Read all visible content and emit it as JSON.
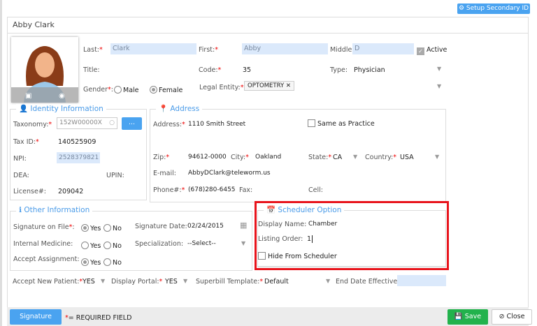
{
  "header": {
    "setup_secondary_id": "Setup Secondary ID",
    "title": "Abby Clark"
  },
  "name": {
    "last_label": "Last:",
    "last": "Clark",
    "first_label": "First:",
    "first": "Abby",
    "middle_label": "Middle:",
    "middle": "D",
    "active_label": "Active",
    "active": true
  },
  "row2": {
    "title_label": "Title:",
    "code_label": "Code:",
    "code": "35",
    "type_label": "Type:",
    "type": "Physician"
  },
  "row3": {
    "gender_label": "Gender",
    "male": "Male",
    "female": "Female",
    "gender": "Female",
    "legal_entity_label": "Legal Entity:",
    "legal_entity": "OPTOMETRY"
  },
  "identity": {
    "legend": "Identity Information",
    "taxonomy_label": "Taxonomy:",
    "taxonomy": "152W00000X",
    "browse": "...",
    "taxid_label": "Tax ID:",
    "taxid": "140525909",
    "npi_label": "NPI:",
    "npi": "2528379821",
    "dea_label": "DEA:",
    "upin_label": "UPIN:",
    "license_label": "License#:",
    "license": "209042"
  },
  "address": {
    "legend": "Address",
    "address_label": "Address:",
    "address": "1110 Smith Street",
    "same_as_practice": "Same as Practice",
    "zip_label": "Zip:",
    "zip": "94612-0000",
    "city_label": "City:",
    "city": "Oakland",
    "state_label": "State:",
    "state": "CA",
    "country_label": "Country:",
    "country": "USA",
    "email_label": "E-mail:",
    "email": "AbbyDClark@teleworm.us",
    "phone_label": "Phone#:",
    "phone": "(678)280-6455",
    "fax_label": "Fax:",
    "cell_label": "Cell:"
  },
  "other": {
    "legend": "Other Information",
    "sig_on_file_label": "Signature on File",
    "internal_med_label": "Internal Medicine:",
    "accept_assign_label": "Accept Assignment:",
    "yes": "Yes",
    "no": "No",
    "sig_date_label": "Signature Date:",
    "sig_date": "02/24/2015",
    "specialization_label": "Specialization:",
    "specialization": "--Select--"
  },
  "scheduler": {
    "legend": "Scheduler Option",
    "display_name_label": "Display Name:",
    "display_name": "Chamber",
    "listing_order_label": "Listing Order:",
    "listing_order": "1",
    "hide_label": "Hide From Scheduler"
  },
  "bottom": {
    "accept_new_label": "Accept New Patient:",
    "accept_new": "YES",
    "display_portal_label": "Display Portal:",
    "display_portal": "YES",
    "superbill_label": "Superbill Template:",
    "superbill": "Default",
    "end_date_label": "End Date Effective:",
    "end_date": ""
  },
  "footer": {
    "signature": "Signature",
    "required_note": "= REQUIRED FIELD",
    "save": "Save",
    "close": "Close"
  },
  "colors": {
    "accent": "#4aa3f0",
    "save": "#22b24c",
    "highlight": "#e8141c"
  }
}
